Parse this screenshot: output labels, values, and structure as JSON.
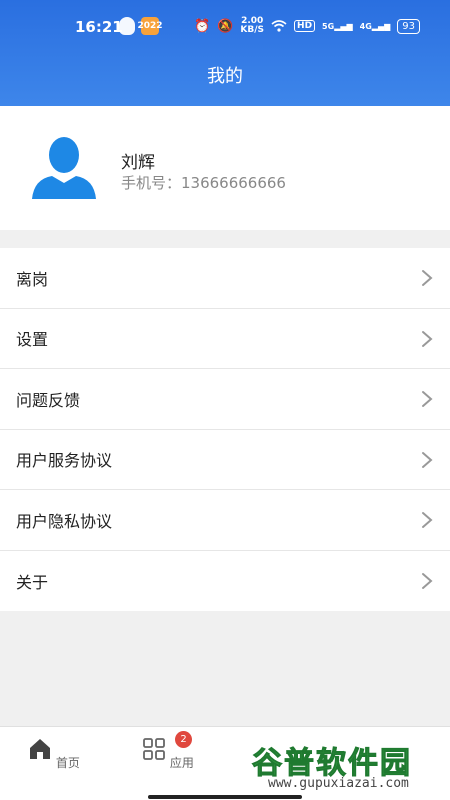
{
  "status_bar": {
    "time": "16:21",
    "app_badge": "2022",
    "speed_value": "2.00",
    "speed_unit": "KB/S",
    "hd": "HD",
    "sig1": "5G",
    "sig2": "4G",
    "battery": "93"
  },
  "header": {
    "title": "我的"
  },
  "profile": {
    "name": "刘辉",
    "phone": "手机号：13666666666"
  },
  "menu": {
    "items": [
      {
        "label": "离岗"
      },
      {
        "label": "设置"
      },
      {
        "label": "问题反馈"
      },
      {
        "label": "用户服务协议"
      },
      {
        "label": "用户隐私协议"
      },
      {
        "label": "关于"
      }
    ]
  },
  "tabbar": {
    "home": "首页",
    "apps": "应用",
    "apps_badge": "2"
  },
  "watermark": {
    "main": "谷普软件园",
    "url": "www.gupuxiazai.com"
  },
  "colors": {
    "header": "#3a80e8",
    "avatar": "#1e88e5",
    "badge": "#e0483e"
  }
}
